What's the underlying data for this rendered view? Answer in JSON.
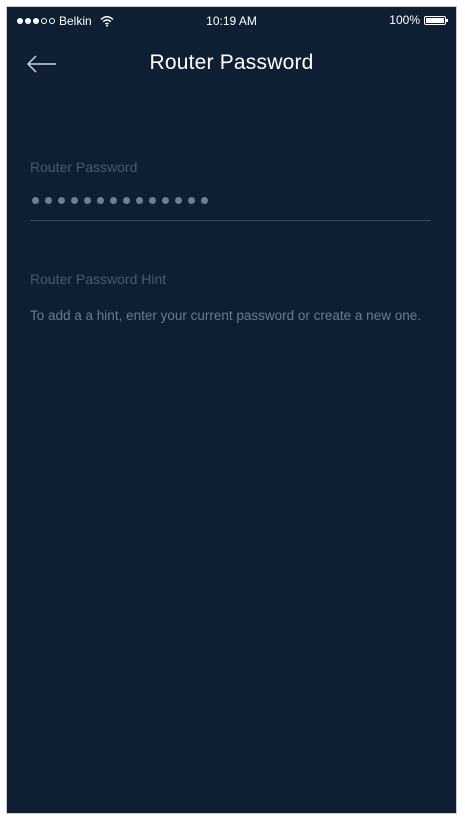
{
  "status_bar": {
    "signal_full": 3,
    "signal_empty": 2,
    "carrier": "Belkin",
    "wifi_icon": "wifi-icon",
    "time": "10:19 AM",
    "battery": "100%"
  },
  "nav": {
    "back_icon": "arrow-left-icon",
    "title": "Router Password"
  },
  "form": {
    "password_label": "Router Password",
    "password_dot_count": 14,
    "hint_label": "Router Password Hint",
    "hint_help": "To add a a hint, enter your current password or create a new one."
  },
  "colors": {
    "background": "#0f1f33",
    "text_primary": "#ffffff",
    "text_muted": "#4a5b6e"
  }
}
